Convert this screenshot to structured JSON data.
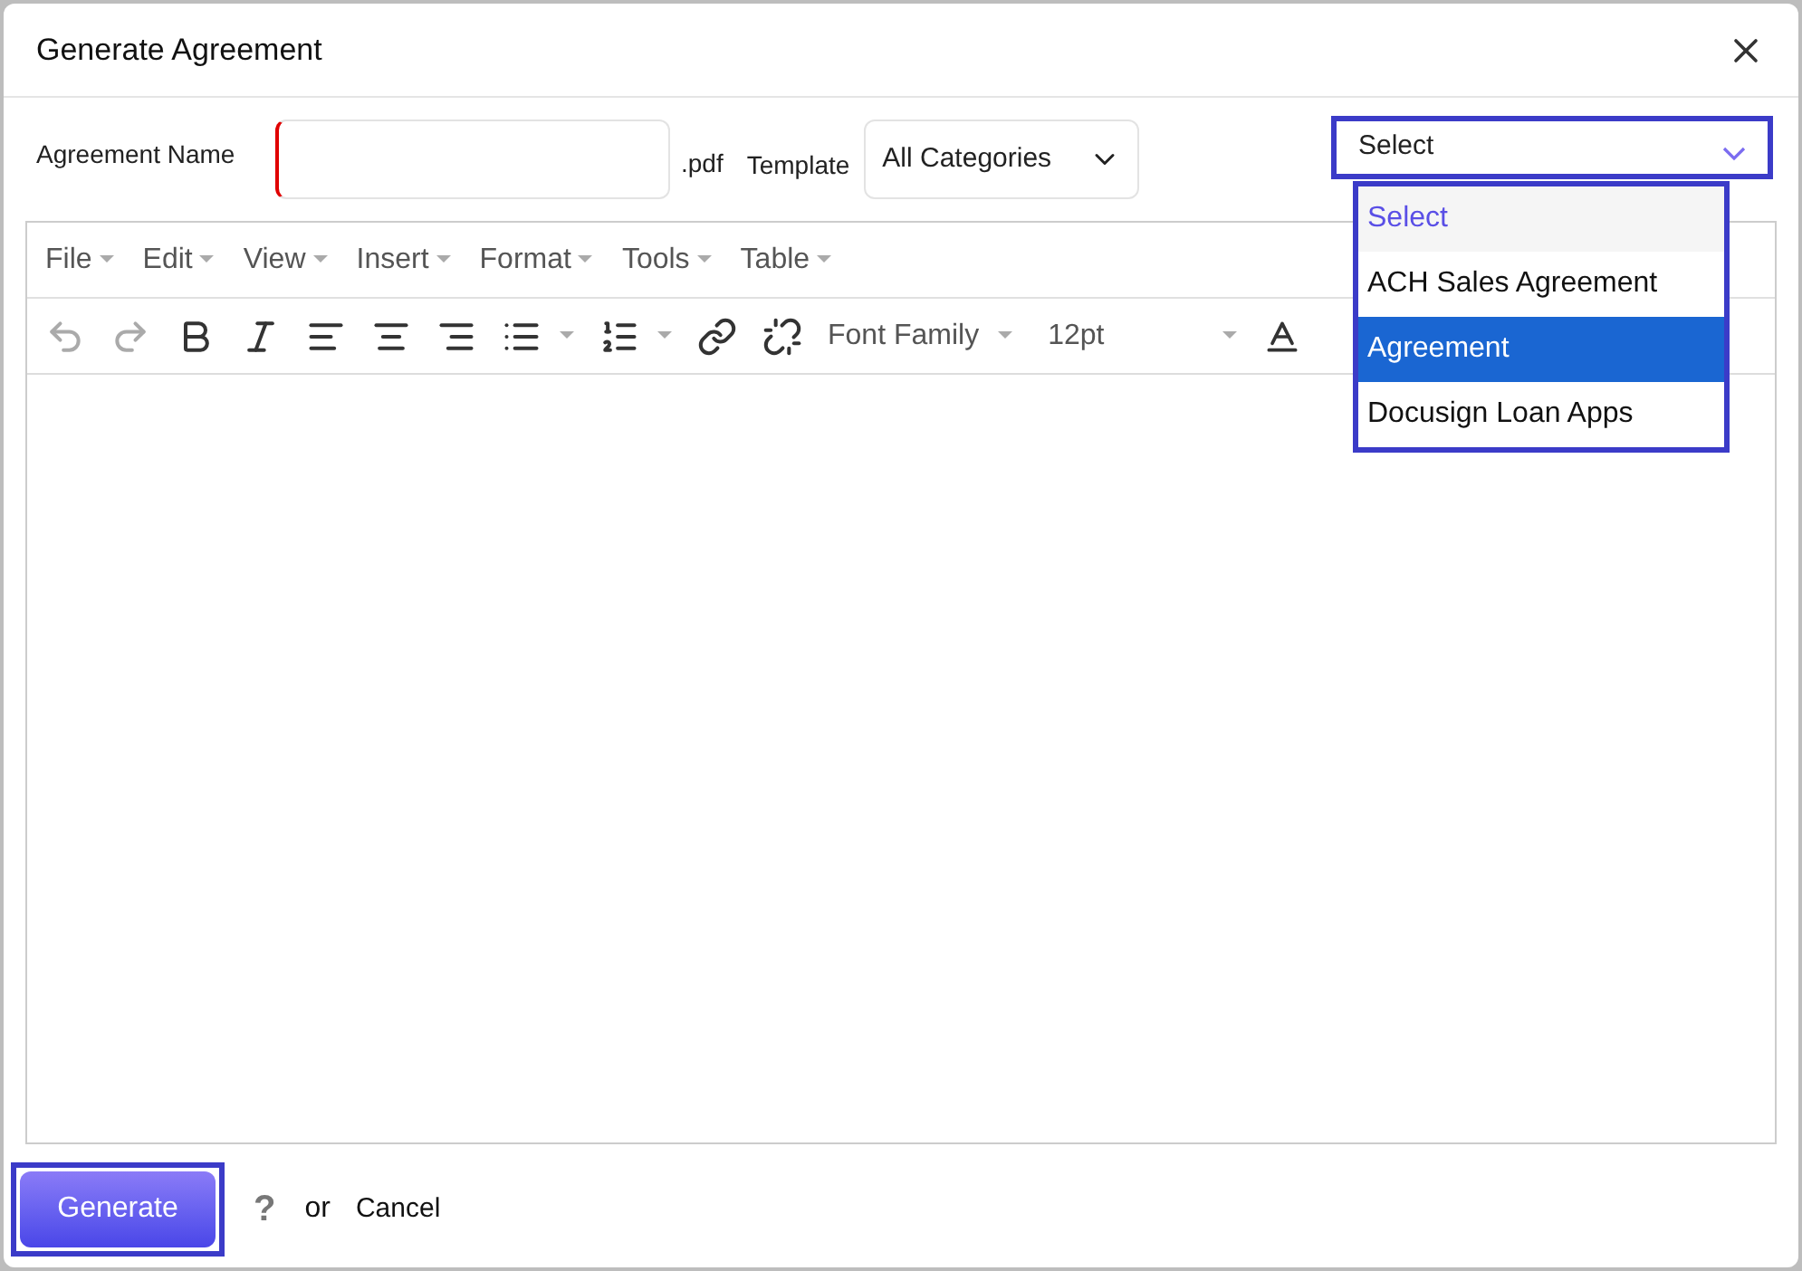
{
  "dialog": {
    "title": "Generate Agreement"
  },
  "form": {
    "name_label": "Agreement Name",
    "name_required": true,
    "extension": ".pdf",
    "template_label": "Template",
    "category_select": {
      "value": "All Categories"
    },
    "template_select": {
      "value": "Select",
      "expanded": true,
      "options": [
        {
          "label": "Select",
          "selected": true,
          "highlighted": false
        },
        {
          "label": "ACH Sales Agreement",
          "selected": false,
          "highlighted": false
        },
        {
          "label": "Agreement",
          "selected": false,
          "highlighted": true
        },
        {
          "label": "Docusign Loan Apps",
          "selected": false,
          "highlighted": false
        }
      ]
    }
  },
  "editor": {
    "menus": [
      "File",
      "Edit",
      "View",
      "Insert",
      "Format",
      "Tools",
      "Table"
    ],
    "toolbar": [
      {
        "kind": "undo",
        "disabled": true
      },
      {
        "kind": "redo",
        "disabled": true
      },
      {
        "kind": "bold",
        "disabled": false
      },
      {
        "kind": "italic",
        "disabled": false
      },
      {
        "kind": "align-left",
        "disabled": false
      },
      {
        "kind": "align-center",
        "disabled": false
      },
      {
        "kind": "align-right",
        "disabled": false
      },
      {
        "kind": "bullets",
        "disabled": false
      },
      {
        "kind": "numbers",
        "disabled": false
      },
      {
        "kind": "link",
        "disabled": false
      },
      {
        "kind": "unlink",
        "disabled": false
      }
    ],
    "font_family": "Font Family",
    "font_size": "12pt"
  },
  "footer": {
    "generate": "Generate",
    "help": "?",
    "or": "or",
    "cancel": "Cancel"
  }
}
